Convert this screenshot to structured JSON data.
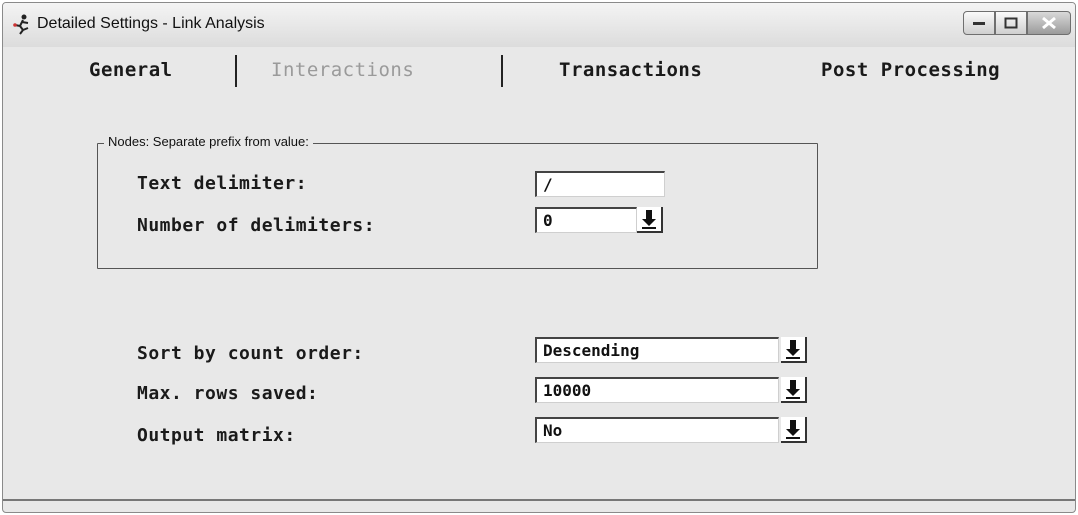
{
  "window": {
    "title": "Detailed Settings - Link Analysis",
    "icons": [
      "app-icon",
      "minimize-icon",
      "maximize-icon",
      "close-icon"
    ]
  },
  "tabs": [
    {
      "label": "General",
      "active": false
    },
    {
      "label": "Interactions",
      "active": true
    },
    {
      "label": "Transactions",
      "active": false
    },
    {
      "label": "Post Processing",
      "active": false
    }
  ],
  "nodes_group": {
    "legend": "Nodes: Separate prefix from value:",
    "text_delimiter": {
      "label": "Text delimiter:",
      "value": "/"
    },
    "number_of_delimiters": {
      "label": "Number of delimiters:",
      "value": "0"
    }
  },
  "options": {
    "sort_by_count_order": {
      "label": "Sort by count order:",
      "value": "Descending"
    },
    "max_rows_saved": {
      "label": "Max. rows saved:",
      "value": "10000"
    },
    "output_matrix": {
      "label": "Output matrix:",
      "value": "No"
    }
  },
  "colors": {
    "window_bg": "#e8e8e8",
    "active_tab_text": "#9a9a9a",
    "field_bg": "#ffffff"
  }
}
